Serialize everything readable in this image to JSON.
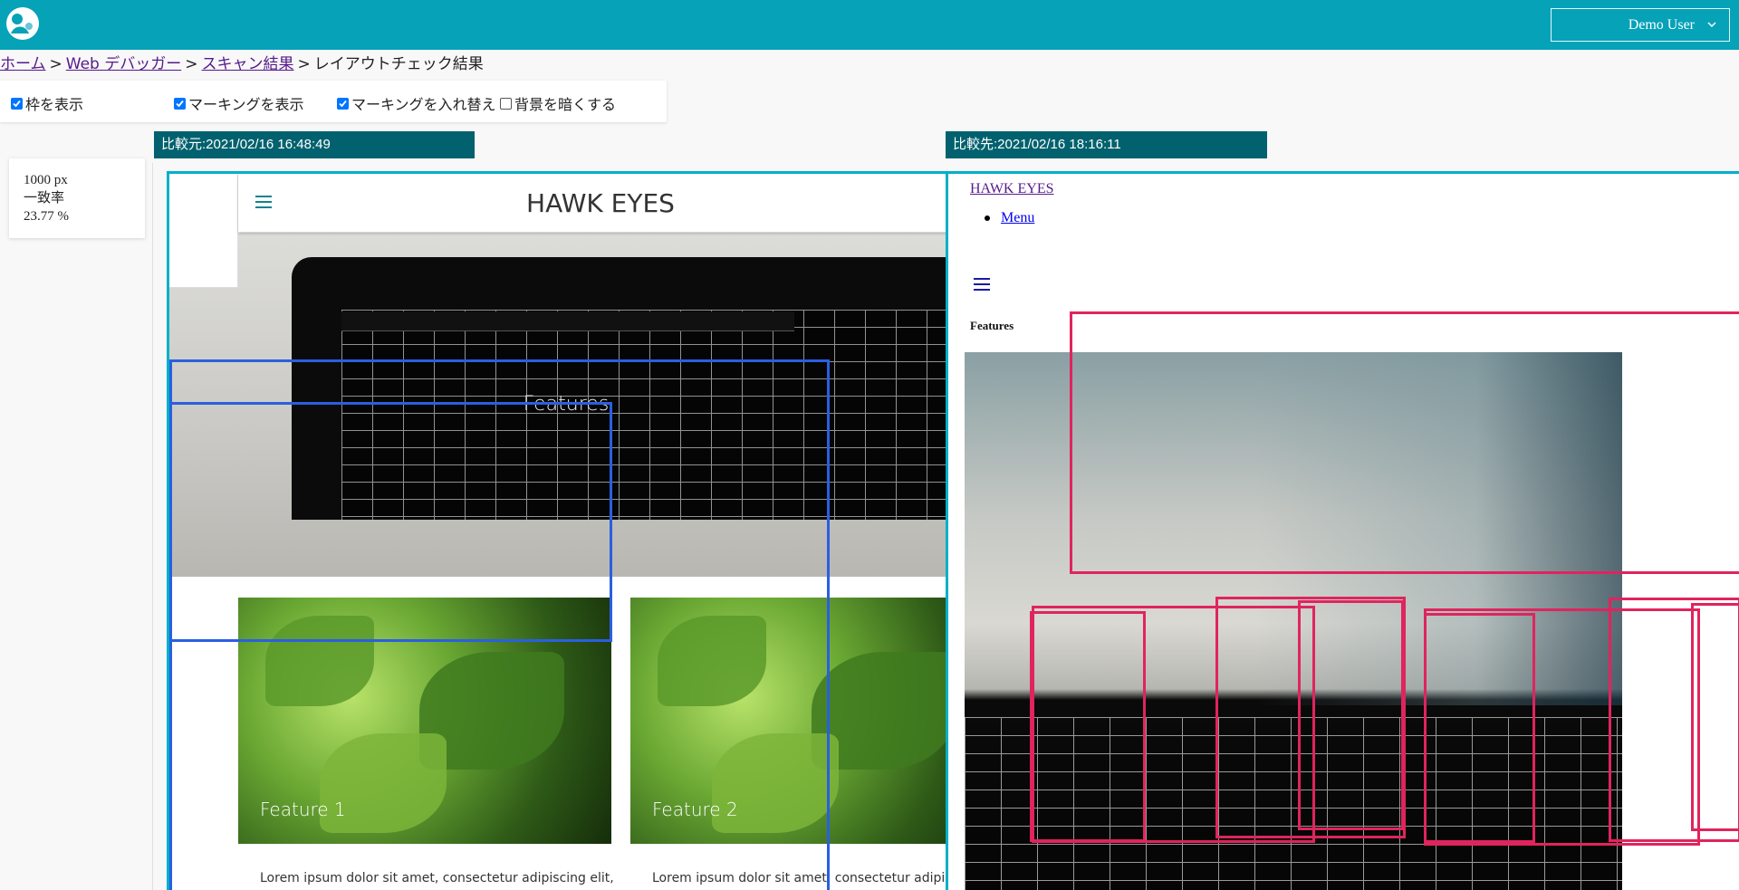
{
  "header": {
    "user_label": "Demo User",
    "accent_color": "#06a2b8"
  },
  "breadcrumb": {
    "items": [
      "ホーム",
      "Web デバッガー",
      "スキャン結果"
    ],
    "current": "レイアウトチェック結果",
    "separator": ">"
  },
  "toolbar": {
    "show_frame": {
      "label": "枠を表示",
      "checked": true
    },
    "show_marking": {
      "label": "マーキングを表示",
      "checked": true
    },
    "swap_marking": {
      "label": "マーキングを入れ替え",
      "checked": true
    },
    "darken_bg": {
      "label": "背景を暗くする",
      "checked": false
    }
  },
  "stats": {
    "width": "1000 px",
    "match_label": "一致率",
    "match_value": "23.77 %"
  },
  "source": {
    "header": "比較元:2021/02/16 16:48:49",
    "page": {
      "title": "HAWK EYES",
      "hero_label": "Features",
      "cards": [
        {
          "label": "Feature 1",
          "text": "Lorem ipsum dolor sit amet, consectetur adipiscing elit,"
        },
        {
          "label": "Feature 2",
          "text": "Lorem ipsum dolor sit amet, consectetur adipiscing"
        }
      ]
    }
  },
  "target": {
    "header": "比較先:2021/02/16 18:16:11",
    "page": {
      "title_link": "HAWK EYES",
      "menu_item": "Menu",
      "features_heading": "Features"
    }
  },
  "colors": {
    "frame": "#00b0c8",
    "header_bg": "#02616e",
    "marking_blue": "#2a5fe0",
    "marking_red": "#e0245e"
  }
}
